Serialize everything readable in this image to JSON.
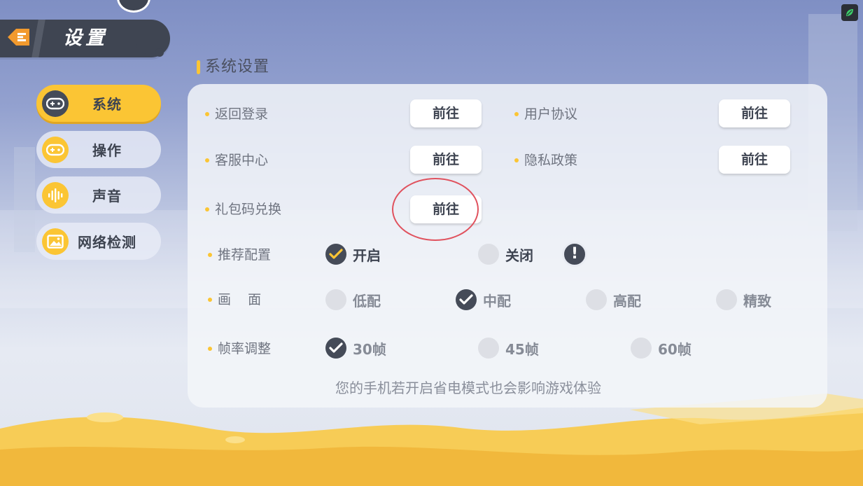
{
  "header": {
    "title": "设置",
    "back_icon": "back-arrow-icon",
    "avatar_icon": "avatar"
  },
  "sidebar": {
    "items": [
      {
        "label": "系统",
        "icon": "gamepad-icon",
        "active": true
      },
      {
        "label": "操作",
        "icon": "controller-icon",
        "active": false
      },
      {
        "label": "声音",
        "icon": "sound-wave-icon",
        "active": false
      },
      {
        "label": "网络检测",
        "icon": "image-icon",
        "active": false
      }
    ]
  },
  "section": {
    "title": "系统设置"
  },
  "links": {
    "go_label": "前往",
    "items": [
      {
        "label": "返回登录"
      },
      {
        "label": "用户协议"
      },
      {
        "label": "客服中心"
      },
      {
        "label": "隐私政策"
      },
      {
        "label": "礼包码兑换"
      }
    ]
  },
  "recommended_config": {
    "label": "推荐配置",
    "options": [
      {
        "label": "开启",
        "checked": true
      },
      {
        "label": "关闭",
        "checked": false
      }
    ],
    "info_icon": "exclamation-icon",
    "info_symbol": "!"
  },
  "graphics": {
    "label": "画    面",
    "options": [
      {
        "label": "低配",
        "checked": false
      },
      {
        "label": "中配",
        "checked": true
      },
      {
        "label": "高配",
        "checked": false
      },
      {
        "label": "精致",
        "checked": false
      }
    ]
  },
  "frame_rate": {
    "label": "帧率调整",
    "options": [
      {
        "label": "30帧",
        "checked": true
      },
      {
        "label": "45帧",
        "checked": false
      },
      {
        "label": "60帧",
        "checked": false
      }
    ]
  },
  "tip": "您的手机若开启省电模式也会影响游戏体验",
  "colors": {
    "accent": "#fbc534",
    "dark": "#454b58",
    "highlight_ring": "#e0525e"
  },
  "top_right_icon": "leaf-icon"
}
